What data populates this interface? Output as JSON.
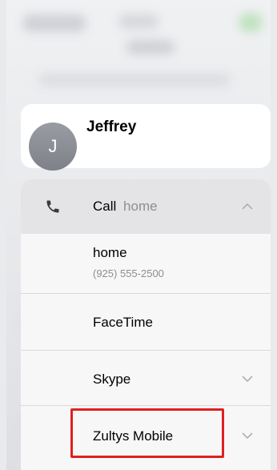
{
  "contact": {
    "initial": "J",
    "name": "Jeffrey"
  },
  "actions": {
    "call": {
      "label": "Call",
      "sublabel": "home",
      "icon": "phone-icon",
      "expanded": true
    },
    "options": [
      {
        "title": "home",
        "subtitle": "(925) 555-2500"
      },
      {
        "title": "FaceTime"
      },
      {
        "title": "Skype",
        "icon": "chevron-down-icon"
      },
      {
        "title": "Zultys Mobile",
        "icon": "chevron-down-icon"
      }
    ]
  },
  "colors": {
    "highlight": "#e02020",
    "avatar": "#8b8d94",
    "secondary_text": "#8e8e93"
  }
}
